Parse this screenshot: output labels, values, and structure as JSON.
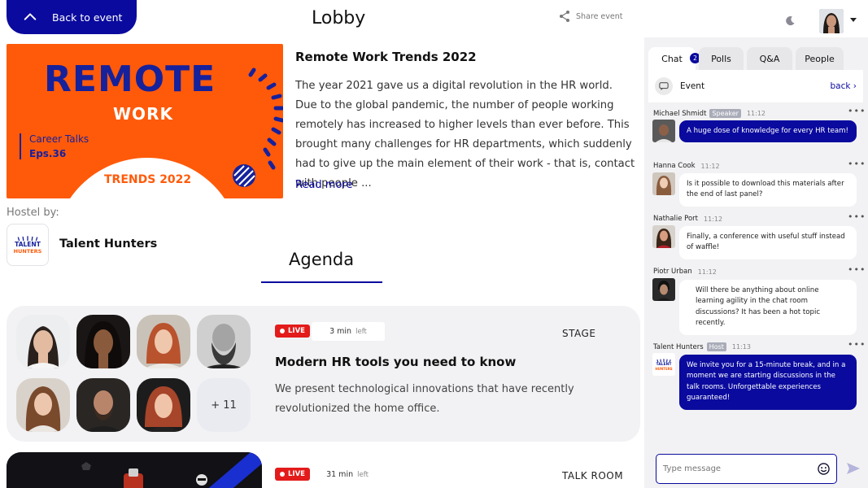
{
  "header": {
    "back_label": "Back to event",
    "title": "Lobby",
    "share_label": "Share event"
  },
  "hero": {
    "image": {
      "line1": "REMOTE",
      "line2": "WORK",
      "series": "Career Talks",
      "episode": "Eps.36",
      "footer": "TRENDS 2022"
    },
    "title": "Remote Work Trends 2022",
    "description": "The year 2021 gave us a digital revolution in the HR world. Due to the global pandemic, the number of people working remotely has increased to higher levels than ever before. This brought many challenges for HR departments, which suddenly had to give up the main element of their work - that is, contact with people ...",
    "read_more": "Read more"
  },
  "host": {
    "label": "Hostel by:",
    "logo_line1": "TALENT",
    "logo_line2": "HUNTERS",
    "name": "Talent Hunters"
  },
  "agenda": {
    "title": "Agenda",
    "sessions": [
      {
        "live_label": "LIVE",
        "time_value": "3 min",
        "time_suffix": "left",
        "room": "STAGE",
        "title": "Modern HR tools you need to know",
        "description": "We present technological innovations that have recently revolutionized the home office.",
        "more_count": "+ 11"
      },
      {
        "live_label": "LIVE",
        "time_value": "31 min",
        "time_suffix": "left",
        "room": "TALK ROOM"
      }
    ]
  },
  "chat": {
    "tabs": [
      {
        "label": "Chat",
        "badge": "2"
      },
      {
        "label": "Polls"
      },
      {
        "label": "Q&A"
      },
      {
        "label": "People"
      }
    ],
    "event_label": "Event",
    "back_label": "back",
    "messages": [
      {
        "author": "Michael Shmidt",
        "role": "Speaker",
        "time": "11:12",
        "text": "A huge dose of knowledge for every HR team!",
        "style": "blue"
      },
      {
        "author": "Hanna Cook",
        "role": "",
        "time": "11:12",
        "text": "Is it possible to download this materials after the end of last panel?",
        "style": "white"
      },
      {
        "author": "Nathalie Port",
        "role": "",
        "time": "11:12",
        "text": "Finally, a conference with useful stuff instead of waffle!",
        "style": "white"
      },
      {
        "author": "Piotr Urban",
        "role": "",
        "time": "11:12",
        "text": "Will there be anything about online learning agility in the chat room discussions? It has been a hot topic recently.",
        "style": "white"
      },
      {
        "author": "Talent Hunters",
        "role": "Host",
        "time": "11:13",
        "text": "We invite you for a 15-minute break, and in a moment we are starting discussions in the talk rooms. Unforgettable experiences guaranteed!",
        "style": "blue"
      }
    ],
    "input_placeholder": "Type message"
  },
  "colors": {
    "brand_blue": "#0a0a9e",
    "hero_orange": "#ff5a0a",
    "live_red": "#e31b1b"
  }
}
